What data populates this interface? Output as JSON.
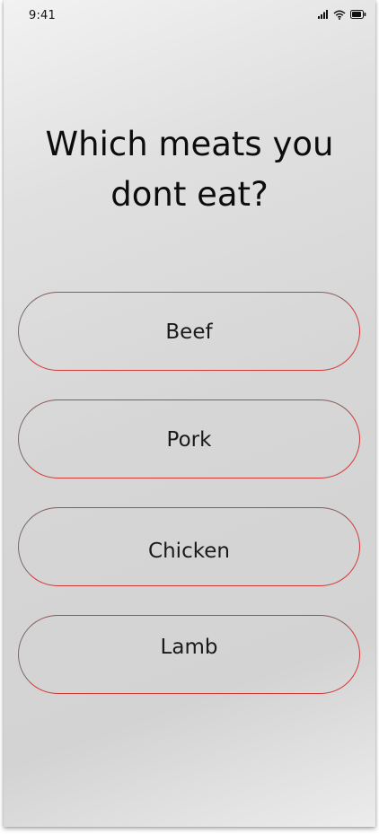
{
  "status_bar": {
    "time": "9:41",
    "icons": [
      "cellular-signal-icon",
      "wifi-icon",
      "battery-icon"
    ]
  },
  "question": {
    "line1": "Which meats you",
    "line2": "dont eat?"
  },
  "options": [
    {
      "label": "Beef"
    },
    {
      "label": "Pork"
    },
    {
      "label": "Chicken"
    },
    {
      "label": "Lamb"
    }
  ],
  "colors": {
    "option_border": "#d43a3a",
    "text": "#0c0c0c",
    "background": "#d6d6d6"
  }
}
